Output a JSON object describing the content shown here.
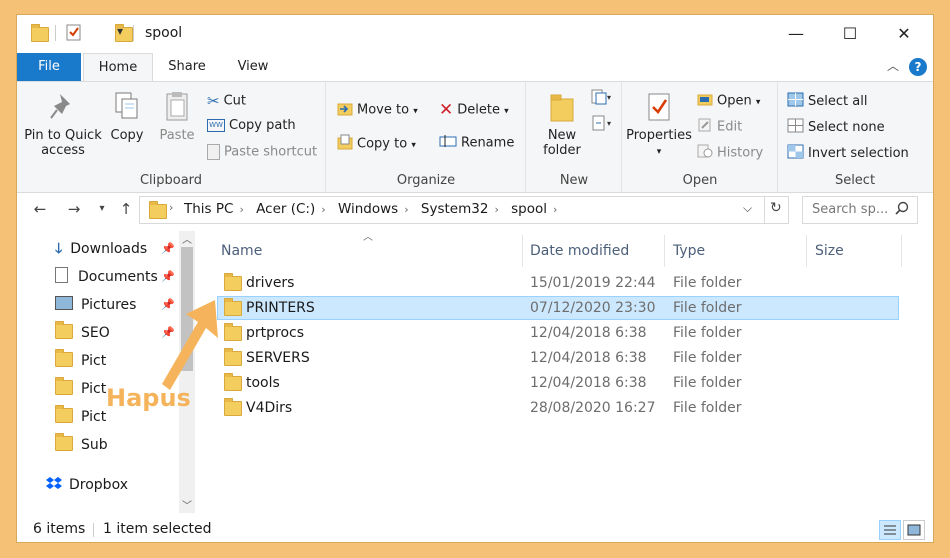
{
  "window": {
    "title": "spool",
    "controls": {
      "minimize": "—",
      "maximize": "☐",
      "close": "✕"
    }
  },
  "ribbon_tabs": [
    {
      "label": "File"
    },
    {
      "label": "Home"
    },
    {
      "label": "Share"
    },
    {
      "label": "View"
    }
  ],
  "help_label": "?",
  "ribbon": {
    "clipboard": {
      "label": "Clipboard",
      "pin_label": "Pin to Quick access",
      "copy_label": "Copy",
      "paste_label": "Paste",
      "cut_label": "Cut",
      "copy_path_label": "Copy path",
      "paste_shortcut_label": "Paste shortcut"
    },
    "organize": {
      "label": "Organize",
      "move_to_label": "Move to",
      "copy_to_label": "Copy to",
      "delete_label": "Delete",
      "rename_label": "Rename"
    },
    "new": {
      "label": "New",
      "new_folder_label": "New folder"
    },
    "open": {
      "label": "Open",
      "properties_label": "Properties",
      "open_label": "Open",
      "edit_label": "Edit",
      "history_label": "History"
    },
    "select": {
      "label": "Select",
      "select_all_label": "Select all",
      "select_none_label": "Select none",
      "invert_label": "Invert selection"
    }
  },
  "address": {
    "crumbs": [
      "This PC",
      "Acer (C:)",
      "Windows",
      "System32",
      "spool"
    ],
    "search_placeholder": "Search sp..."
  },
  "nav_pane": [
    {
      "label": "Downloads",
      "icon": "download-icon",
      "pinned": true
    },
    {
      "label": "Documents",
      "icon": "document-icon",
      "pinned": true
    },
    {
      "label": "Pictures",
      "icon": "pictures-icon",
      "pinned": true
    },
    {
      "label": "SEO",
      "icon": "folder-icon",
      "pinned": true
    },
    {
      "label": "Pict",
      "icon": "folder-icon",
      "pinned": false
    },
    {
      "label": "Pict",
      "icon": "folder-icon",
      "pinned": false
    },
    {
      "label": "Pict",
      "icon": "folder-icon",
      "pinned": false
    },
    {
      "label": "Sub",
      "icon": "folder-icon",
      "pinned": false
    },
    {
      "label": "Dropbox",
      "icon": "dropbox-icon",
      "pinned": false
    }
  ],
  "columns": {
    "name": "Name",
    "date": "Date modified",
    "type": "Type",
    "size": "Size"
  },
  "files": [
    {
      "name": "drivers",
      "date": "15/01/2019 22:44",
      "type": "File folder",
      "selected": false
    },
    {
      "name": "PRINTERS",
      "date": "07/12/2020 23:30",
      "type": "File folder",
      "selected": true
    },
    {
      "name": "prtprocs",
      "date": "12/04/2018 6:38",
      "type": "File folder",
      "selected": false
    },
    {
      "name": "SERVERS",
      "date": "12/04/2018 6:38",
      "type": "File folder",
      "selected": false
    },
    {
      "name": "tools",
      "date": "12/04/2018 6:38",
      "type": "File folder",
      "selected": false
    },
    {
      "name": "V4Dirs",
      "date": "28/08/2020 16:27",
      "type": "File folder",
      "selected": false
    }
  ],
  "status": {
    "items": "6 items",
    "selected": "1 item selected"
  },
  "annotation": {
    "text": "Hapus",
    "color": "#f5b45b"
  },
  "colors": {
    "accent": "#1979ca",
    "selection": "#cce8ff",
    "frame": "#f5c177"
  }
}
